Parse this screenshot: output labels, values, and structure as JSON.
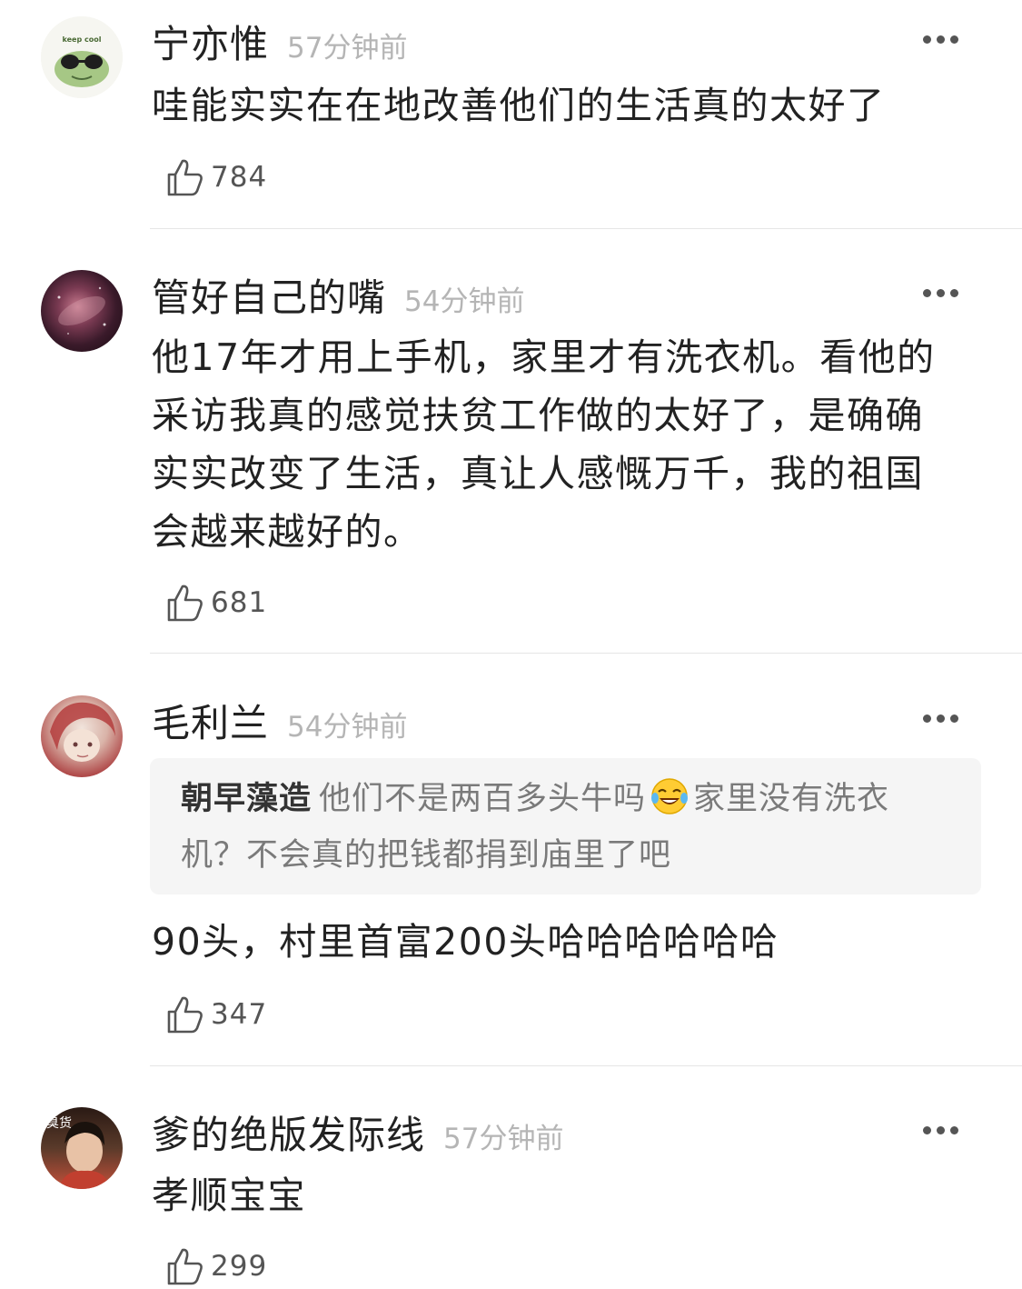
{
  "comments": [
    {
      "username": "宁亦惟",
      "time": "57分钟前",
      "text": "哇能实实在在地改善他们的生活真的太好了",
      "likes": "784",
      "avatar_text": "keep cool"
    },
    {
      "username": "管好自己的嘴",
      "time": "54分钟前",
      "text": "他17年才用上手机，家里才有洗衣机。看他的采访我真的感觉扶贫工作做的太好了，是确确实实改变了生活，真让人感慨万千，我的祖国会越来越好的。",
      "likes": "681"
    },
    {
      "username": "毛利兰",
      "time": "54分钟前",
      "quote": {
        "author": "朝早藻造",
        "text_before_emoji": "他们不是两百多头牛吗",
        "emoji": "tears-of-joy-emoji",
        "text_after_emoji": "家里没有洗衣机？不会真的把钱都捐到庙里了吧"
      },
      "text": "90头，村里首富200头哈哈哈哈哈哈",
      "likes": "347"
    },
    {
      "username": "爹的绝版发际线",
      "time": "57分钟前",
      "text": "孝顺宝宝",
      "likes": "299",
      "avatar_text": "臭货"
    }
  ],
  "colors": {
    "username": "#222222",
    "timestamp": "#b5b5b5",
    "quote_background": "#f5f5f5",
    "divider": "#e6e6e6"
  }
}
